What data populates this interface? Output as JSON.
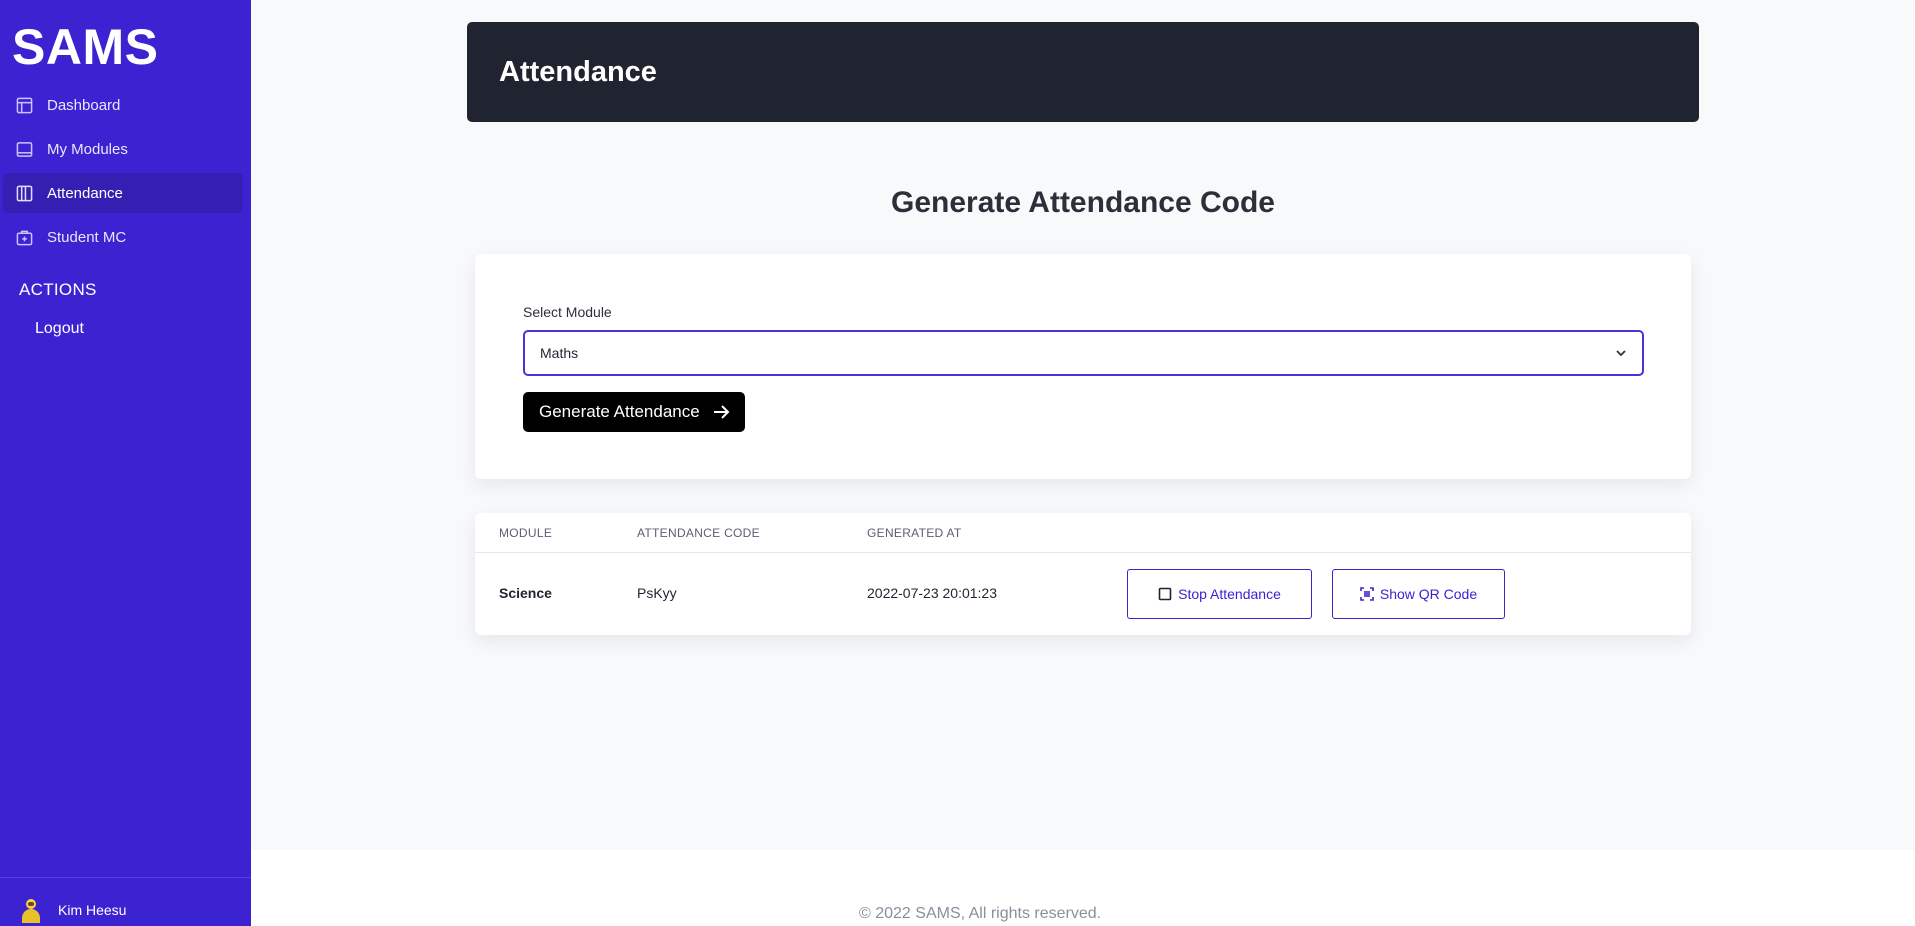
{
  "app": {
    "logo": "SAMS"
  },
  "sidebar": {
    "items": [
      {
        "label": "Dashboard",
        "icon": "layout-icon"
      },
      {
        "label": "My Modules",
        "icon": "tablet-icon"
      },
      {
        "label": "Attendance",
        "icon": "columns-icon",
        "active": true
      },
      {
        "label": "Student MC",
        "icon": "medical-kit-icon"
      }
    ],
    "actions_heading": "ACTIONS",
    "logout_label": "Logout",
    "user_name": "Kim Heesu"
  },
  "header": {
    "title": "Attendance"
  },
  "main": {
    "section_title": "Generate Attendance Code",
    "form": {
      "select_label": "Select Module",
      "selected_module": "Maths",
      "generate_label": "Generate Attendance"
    },
    "table": {
      "columns": [
        "MODULE",
        "ATTENDANCE CODE",
        "GENERATED AT"
      ],
      "rows": [
        {
          "module": "Science",
          "code": "PsKyy",
          "generated_at": "2022-07-23 20:01:23",
          "stop_label": "Stop Attendance",
          "qr_label": "Show QR Code"
        }
      ]
    }
  },
  "footer": {
    "copyright": "© 2022 SAMS, All rights reserved."
  },
  "colors": {
    "sidebar_bg": "#3b23d1",
    "active_item_bg": "#3320b3",
    "header_bg": "#1f2430",
    "accent": "#3b23d1"
  }
}
